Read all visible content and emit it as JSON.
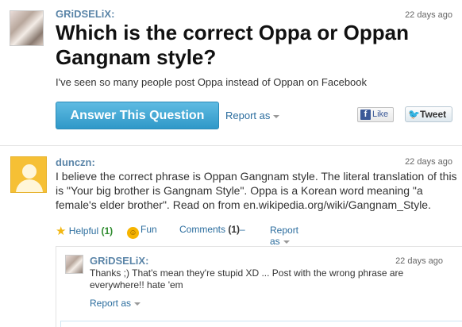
{
  "question": {
    "username": "GRiDSELiX:",
    "time": "22 days ago",
    "title": "Which is the correct Oppa or Oppan Gangnam style?",
    "description": "I've seen so many people post Oppa instead of Oppan on Facebook",
    "answer_button": "Answer This Question",
    "report_label": "Report as",
    "like_label": "Like",
    "tweet_label": "Tweet",
    "icons": {
      "facebook": "facebook-icon",
      "twitter": "twitter-bird-icon"
    }
  },
  "answer": {
    "username": "dunczn:",
    "time": "22 days ago",
    "text": "I believe the correct phrase is Oppan Gangnam style. The literal translation of this is \"Your big brother is Gangnam Style\". Oppa is a Korean word meaning \"a female's elder brother\". Read on from en.wikipedia.org/wiki/Gangnam_Style.",
    "helpful_label": "Helpful",
    "helpful_count": "(1)",
    "fun_label": "Fun",
    "comments_label": "Comments",
    "comments_count": "(1)",
    "comments_toggle": "–",
    "report_label": "Report as"
  },
  "reply": {
    "username": "GRiDSELiX:",
    "time": "22 days ago",
    "text": "Thanks ;) That's mean they're stupid XD ... Post with the wrong phrase are everywhere!! hate 'em",
    "report_label": "Report as"
  },
  "colors": {
    "accent": "#2f98c8",
    "username": "#5b85a8",
    "link": "#2b6d9e",
    "helpful_count": "#2e8b2e"
  }
}
